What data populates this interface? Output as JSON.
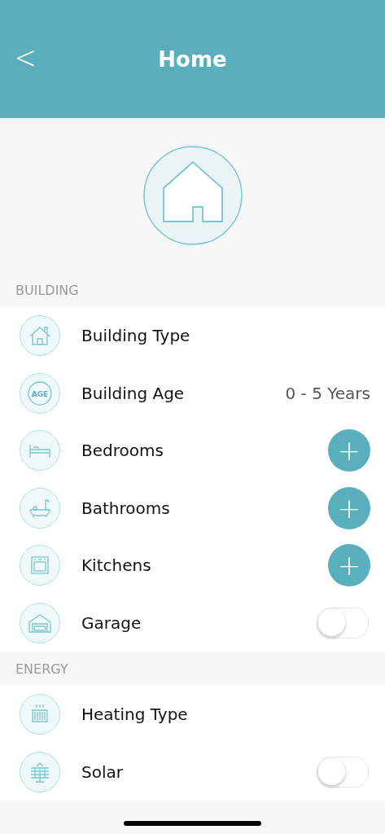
{
  "header": {
    "back": "<",
    "title": "Home"
  },
  "sections": [
    {
      "title": "BUILDING",
      "rows": [
        {
          "label": "Building Type",
          "kind": "plain"
        },
        {
          "icon_text": "AGE",
          "label": "Building Age",
          "kind": "value",
          "value": "0 - 5 Years"
        },
        {
          "label": "Bedrooms",
          "kind": "add",
          "button": "+"
        },
        {
          "label": "Bathrooms",
          "kind": "add",
          "button": "+"
        },
        {
          "label": "Kitchens",
          "kind": "add",
          "button": "+"
        },
        {
          "label": "Garage",
          "kind": "toggle",
          "on": false
        }
      ]
    },
    {
      "title": "ENERGY",
      "rows": [
        {
          "label": "Heating Type",
          "kind": "plain"
        },
        {
          "label": "Solar",
          "kind": "toggle",
          "on": false
        }
      ]
    }
  ]
}
